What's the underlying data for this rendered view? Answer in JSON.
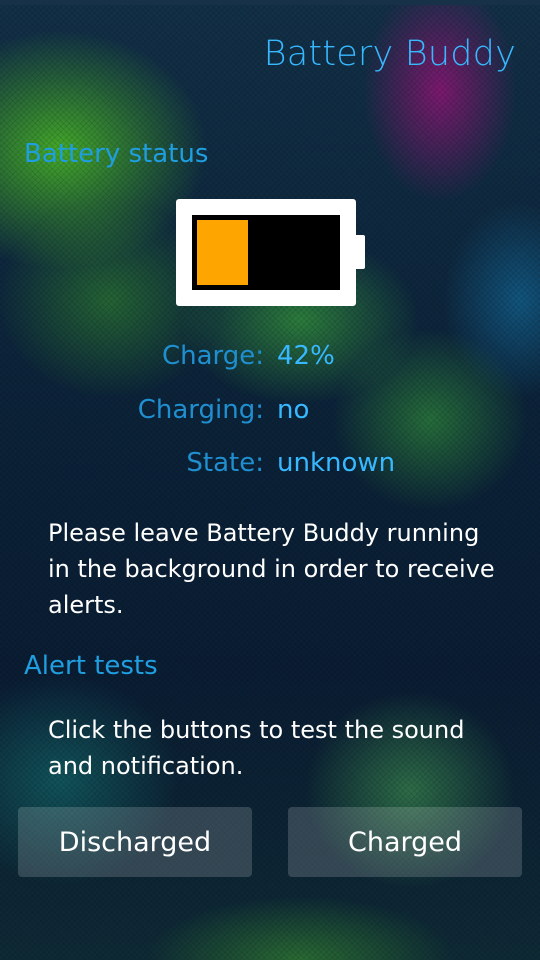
{
  "app": {
    "title": "Battery Buddy"
  },
  "battery_status": {
    "section_title": "Battery status",
    "charge_level": 0.42,
    "fill_color": "#ffa500",
    "rows": [
      {
        "label": "Charge:",
        "value": "42%"
      },
      {
        "label": "Charging:",
        "value": "no"
      },
      {
        "label": "State:",
        "value": "unknown"
      }
    ],
    "note": "Please leave Battery Buddy running in the background in order to receive alerts."
  },
  "alert_tests": {
    "section_title": "Alert tests",
    "note": "Click the buttons to test the sound and notification.",
    "buttons": {
      "discharged": "Discharged",
      "charged": "Charged"
    }
  },
  "colors": {
    "accent": "#37b8ff",
    "secondary": "#1f8fd0"
  }
}
